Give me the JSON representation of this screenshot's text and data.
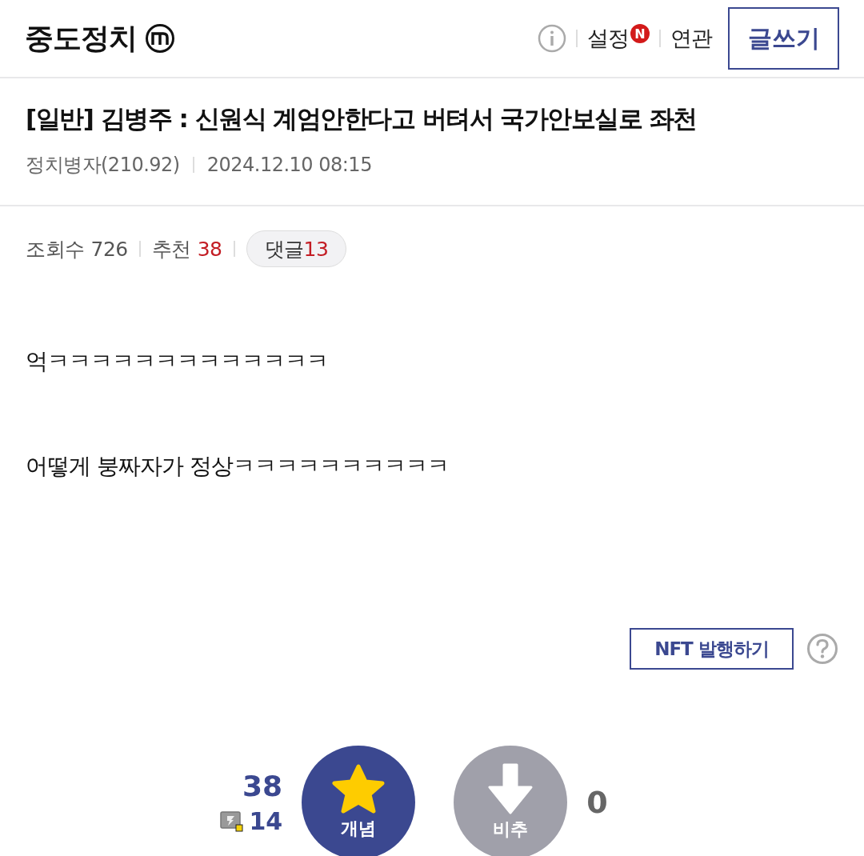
{
  "header": {
    "gallery_title": "중도정치",
    "settings_label": "설정",
    "new_badge": "N",
    "related_label": "연관",
    "write_button": "글쓰기"
  },
  "post": {
    "title": "[일반] 김병주 : 신원식 계엄안한다고 버텨서 국가안보실로 좌천",
    "author": "정치병자(210.92)",
    "date": "2024.12.10 08:15"
  },
  "stats": {
    "views_label": "조회수",
    "views": "726",
    "recommend_label": "추천",
    "recommend": "38",
    "comments_label": "댓글",
    "comments": "13"
  },
  "body": [
    "억ㅋㅋㅋㅋㅋㅋㅋㅋㅋㅋㅋㅋㅋ",
    "어떻게 붕짜자가 정상ㅋㅋㅋㅋㅋㅋㅋㅋㅋㅋ"
  ],
  "nft_button": "NFT 발행하기",
  "vote": {
    "up_count": "38",
    "fixed_count": "14",
    "up_label": "개념",
    "down_label": "비추",
    "down_count": "0"
  }
}
